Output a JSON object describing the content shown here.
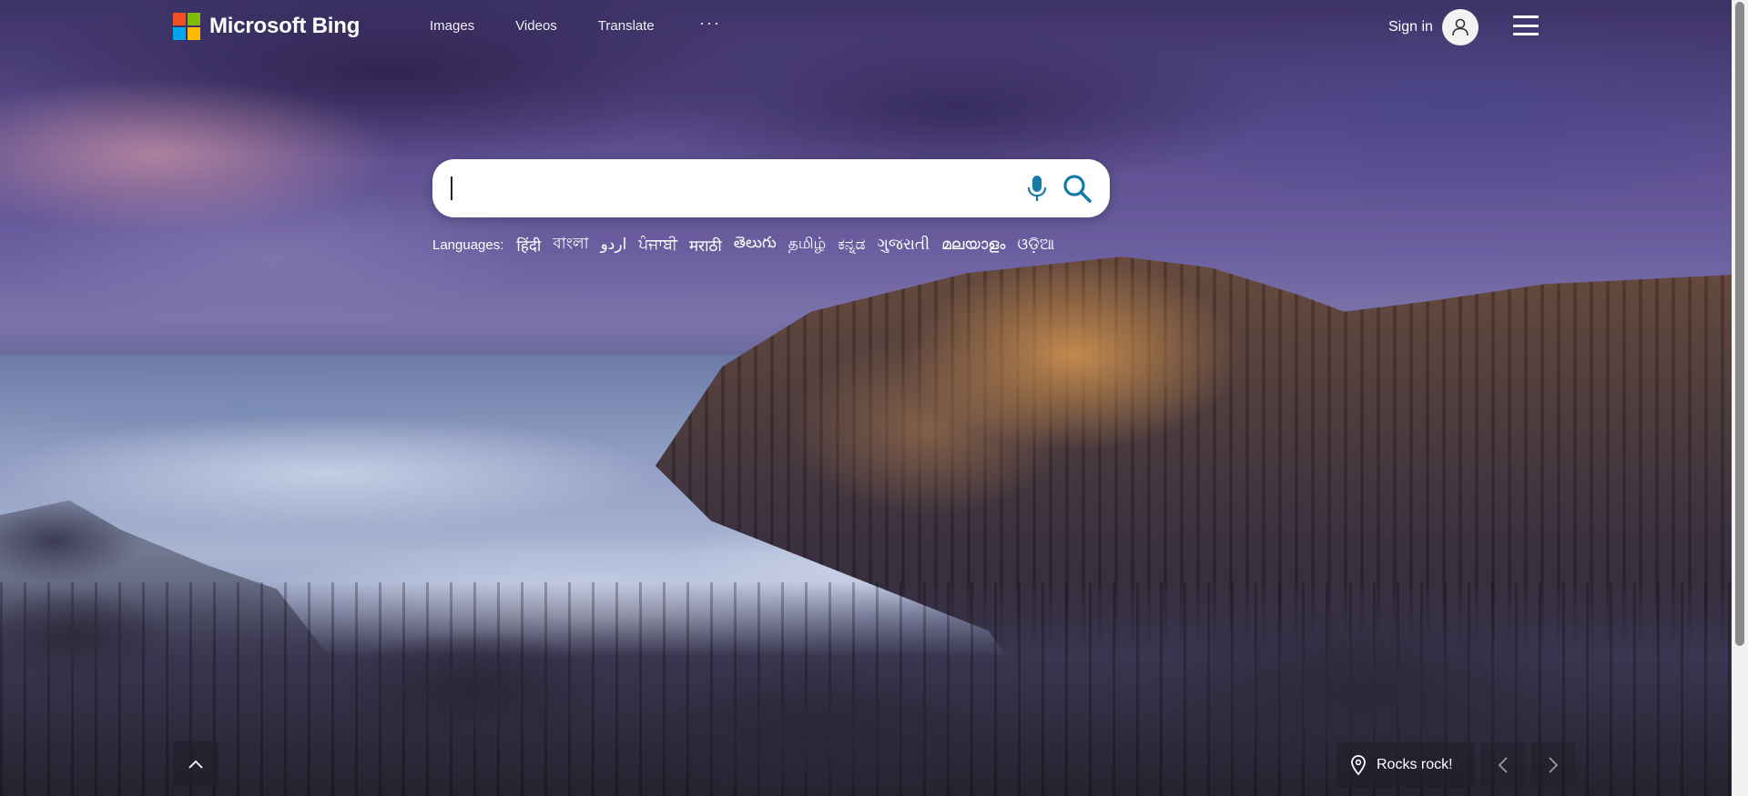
{
  "header": {
    "brand": "Microsoft Bing",
    "nav": [
      "Images",
      "Videos",
      "Translate"
    ],
    "more": "···",
    "signin_label": "Sign in"
  },
  "logo_colors": [
    "#f25022",
    "#7fba00",
    "#00a4ef",
    "#ffb900"
  ],
  "search": {
    "value": "",
    "placeholder": "",
    "mic_icon": "microphone-icon",
    "search_icon": "magnifier-icon",
    "accent": "#177ba5"
  },
  "languages": {
    "label": "Languages:",
    "items": [
      "हिंदी",
      "বাংলা",
      "اردو",
      "ਪੰਜਾਬੀ",
      "मराठी",
      "తెలుగు",
      "தமிழ்",
      "ಕನ್ನಡ",
      "ગુજરાતી",
      "മലയാളം",
      "ଓଡ଼ିଆ"
    ]
  },
  "image_caption": "Rocks rock!",
  "controls": {
    "scroll_up_icon": "chevron-up-icon",
    "prev_icon": "chevron-left-icon",
    "next_icon": "chevron-right-icon",
    "location_icon": "location-pin-icon"
  }
}
